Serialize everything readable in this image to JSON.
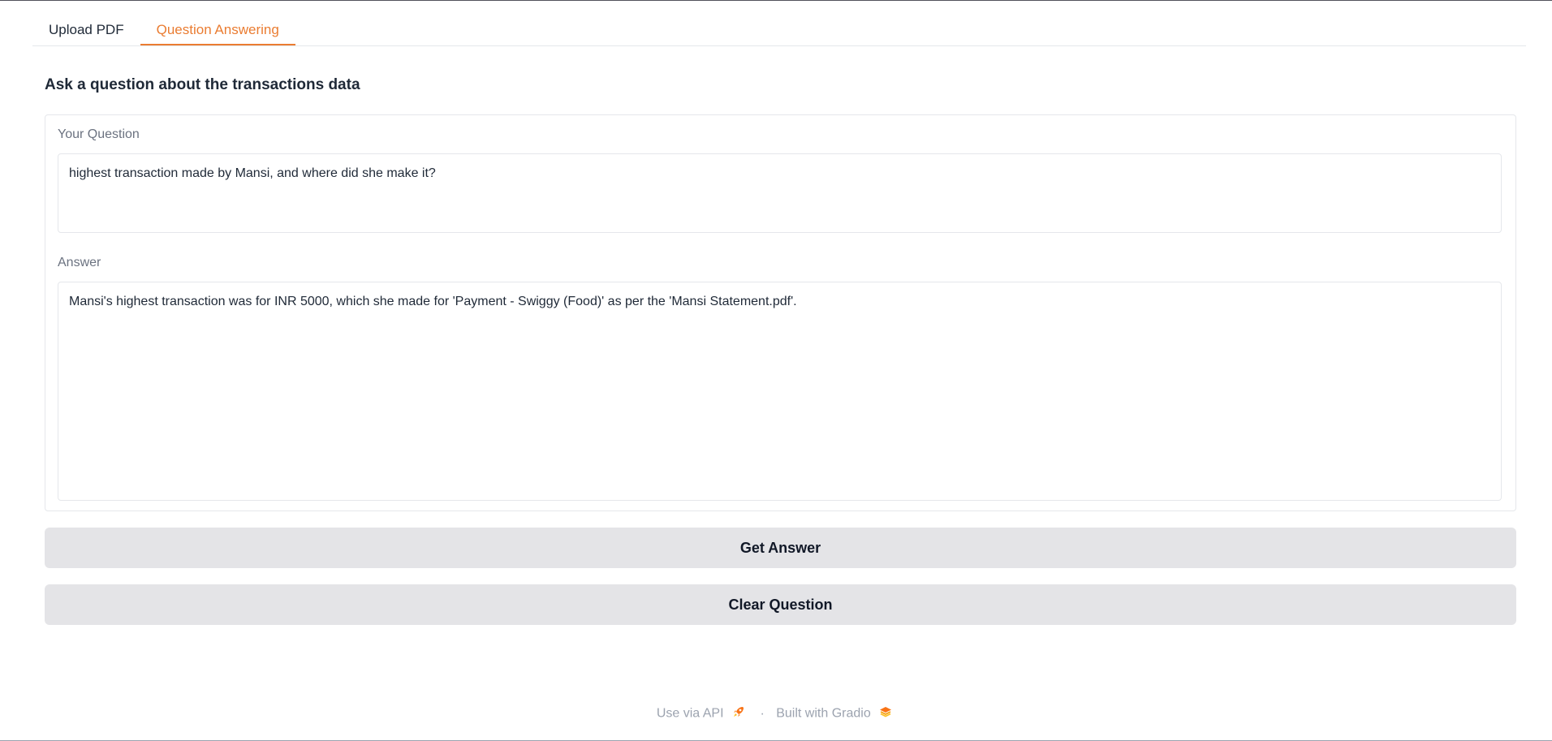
{
  "tabs": [
    {
      "label": "Upload PDF",
      "active": false
    },
    {
      "label": "Question Answering",
      "active": true
    }
  ],
  "heading": "Ask a question about the transactions data",
  "question": {
    "label": "Your Question",
    "value": "highest transaction made by Mansi, and where did she make it?"
  },
  "answer": {
    "label": "Answer",
    "value": "Mansi's highest transaction was for INR 5000, which she made for 'Payment - Swiggy (Food)' as per the 'Mansi Statement.pdf'."
  },
  "buttons": {
    "get_answer": "Get Answer",
    "clear_question": "Clear Question"
  },
  "footer": {
    "api_link": "Use via API",
    "separator": "·",
    "built_with": "Built with Gradio",
    "api_icon": "rocket-icon",
    "gradio_icon": "gradio-logo-icon"
  },
  "colors": {
    "accent": "#ea7c31",
    "button_bg": "#e4e4e7"
  }
}
